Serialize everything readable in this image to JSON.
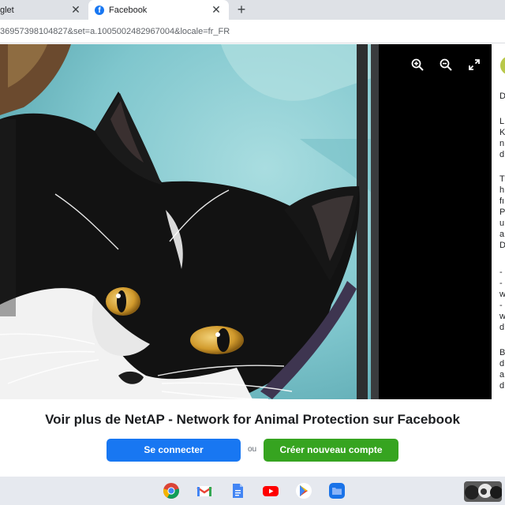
{
  "browser": {
    "tabs": [
      {
        "title": "glet",
        "close": "✕"
      },
      {
        "title": "Facebook",
        "close": "✕",
        "active": true
      }
    ],
    "new_tab": "+",
    "url": "36957398104827&set=a.1005002482967004&locale=fr_FR"
  },
  "viewer": {
    "icons": [
      "zoom-in-icon",
      "zoom-out-icon",
      "fullscreen-icon"
    ],
    "side_panel_letters": [
      "D",
      "L",
      "K",
      "n",
      "d",
      "T",
      "h",
      "fı",
      "P",
      "u",
      "a",
      "D",
      "-",
      "-",
      "w",
      "-",
      "w",
      "d",
      "B",
      "d",
      "a",
      "d"
    ]
  },
  "prompt": {
    "title": "Voir plus de NetAP - Network for Animal Protection sur Facebook",
    "login_label": "Se connecter",
    "or_label": "ou",
    "signup_label": "Créer nouveau compte"
  },
  "shelf": {
    "apps": [
      "chrome-icon",
      "gmail-icon",
      "docs-icon",
      "youtube-icon",
      "play-store-icon",
      "files-icon"
    ]
  },
  "colors": {
    "facebook_blue": "#1877f2",
    "signup_green": "#36a420",
    "tabstrip": "#dee1e6",
    "shelf": "#e6e9ef"
  }
}
